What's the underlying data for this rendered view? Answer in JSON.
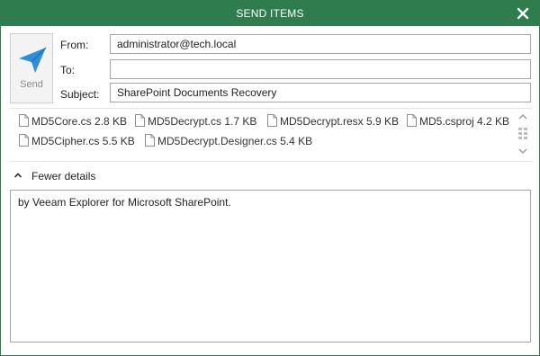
{
  "window": {
    "title": "SEND ITEMS",
    "accent_color": "#2f7d4e",
    "close_icon": "close-icon"
  },
  "send_button": {
    "label": "Send",
    "icon": "paper-plane-icon",
    "icon_color": "#2f8fd6"
  },
  "fields": {
    "from_label": "From:",
    "from_value": "administrator@tech.local",
    "to_label": "To:",
    "to_value": "",
    "subject_label": "Subject:",
    "subject_value": "SharePoint Documents Recovery"
  },
  "attachments": [
    {
      "name": "MD5Core.cs",
      "size": "2.8 KB"
    },
    {
      "name": "MD5Decrypt.cs",
      "size": "1.7 KB"
    },
    {
      "name": "MD5Decrypt.resx",
      "size": "5.9 KB"
    },
    {
      "name": "MD5.csproj",
      "size": "4.2 KB"
    },
    {
      "name": "MD5Cipher.cs",
      "size": "5.5 KB"
    },
    {
      "name": "MD5Decrypt.Designer.cs",
      "size": "5.4 KB"
    }
  ],
  "details_toggle": {
    "label": "Fewer details",
    "icon": "chevron-up-icon"
  },
  "message_body": "by Veeam Explorer for Microsoft SharePoint."
}
